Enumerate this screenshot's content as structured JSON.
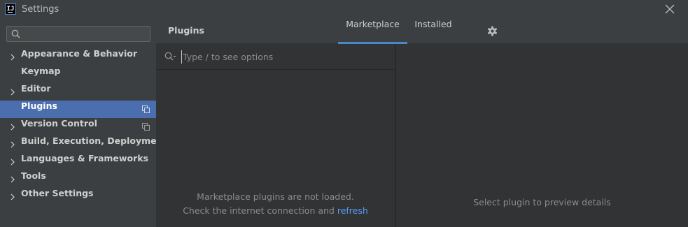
{
  "window": {
    "title": "Settings",
    "logo_text": "IJ"
  },
  "sidebar": {
    "search": {
      "value": "",
      "placeholder": ""
    },
    "items": [
      {
        "label": "Appearance & Behavior",
        "expandable": true
      },
      {
        "label": "Keymap",
        "expandable": false
      },
      {
        "label": "Editor",
        "expandable": true
      },
      {
        "label": "Plugins",
        "expandable": false,
        "selected": true,
        "project_level": true
      },
      {
        "label": "Version Control",
        "expandable": true,
        "project_level": true
      },
      {
        "label": "Build, Execution, Deployment",
        "expandable": true
      },
      {
        "label": "Languages & Frameworks",
        "expandable": true
      },
      {
        "label": "Tools",
        "expandable": true
      },
      {
        "label": "Other Settings",
        "expandable": true
      }
    ]
  },
  "main": {
    "title": "Plugins",
    "tabs": [
      {
        "label": "Marketplace",
        "active": true
      },
      {
        "label": "Installed",
        "active": false
      }
    ],
    "plugin_search": {
      "value": "",
      "placeholder": "Type / to see options"
    },
    "empty_message": {
      "line1": "Marketplace plugins are not loaded.",
      "line2_prefix": "Check the internet connection and",
      "link": "refresh"
    },
    "preview_hint": "Select plugin to preview details"
  },
  "colors": {
    "selection": "#4b6eaf",
    "accent": "#4a88c7",
    "link": "#589df6",
    "panel": "#3c3f41",
    "background": "#2b2b2b"
  },
  "icons": {
    "logo": "intellij-logo-icon",
    "close": "close-icon",
    "search": "search-icon",
    "gear": "gear-icon",
    "chevron": "chevron-right-icon",
    "project_level": "copy-icon"
  }
}
